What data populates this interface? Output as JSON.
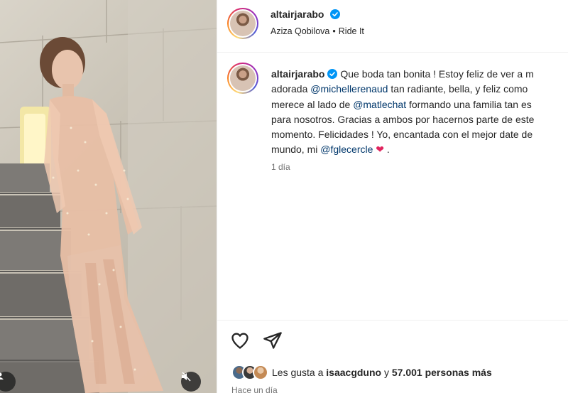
{
  "post": {
    "username": "altairjarabo",
    "audio_artist": "Aziza Qobilova",
    "audio_separator": "•",
    "audio_track": "Ride It"
  },
  "caption": {
    "username": "altairjarabo",
    "line1_text": "Que boda tan bonita ! Estoy feliz de ver a m",
    "line2_pre": "adorada ",
    "mention1": "@michellerenaud",
    "line2_post": " tan radiante, bella, y feliz como",
    "line3_pre": "merece al lado de ",
    "mention2": "@matlechat",
    "line3_post": " formando una familia tan es",
    "line4": "para nosotros. Gracias a ambos por hacernos parte de este",
    "line5": "momento. Felicidades ! Yo, encantada con el mejor date de",
    "line6_pre": "mundo, mi ",
    "mention3": "@fglecercle",
    "heart": "❤",
    "line6_post": " .",
    "time": "1 día"
  },
  "likes": {
    "prefix": "Les gusta a ",
    "user": "isaacgduno",
    "middle": " y ",
    "count": "57.001 personas más"
  },
  "posted_time": "Hace un día",
  "icons": {
    "like": "heart-outline-icon",
    "share": "paper-plane-icon",
    "verified": "verified-badge-icon",
    "mute": "muted-speaker-icon",
    "tag": "user-tag-icon"
  },
  "colors": {
    "mention": "#00376b",
    "verified": "#0095f6",
    "heart": "#e0245e",
    "secondary_text": "#737373"
  }
}
